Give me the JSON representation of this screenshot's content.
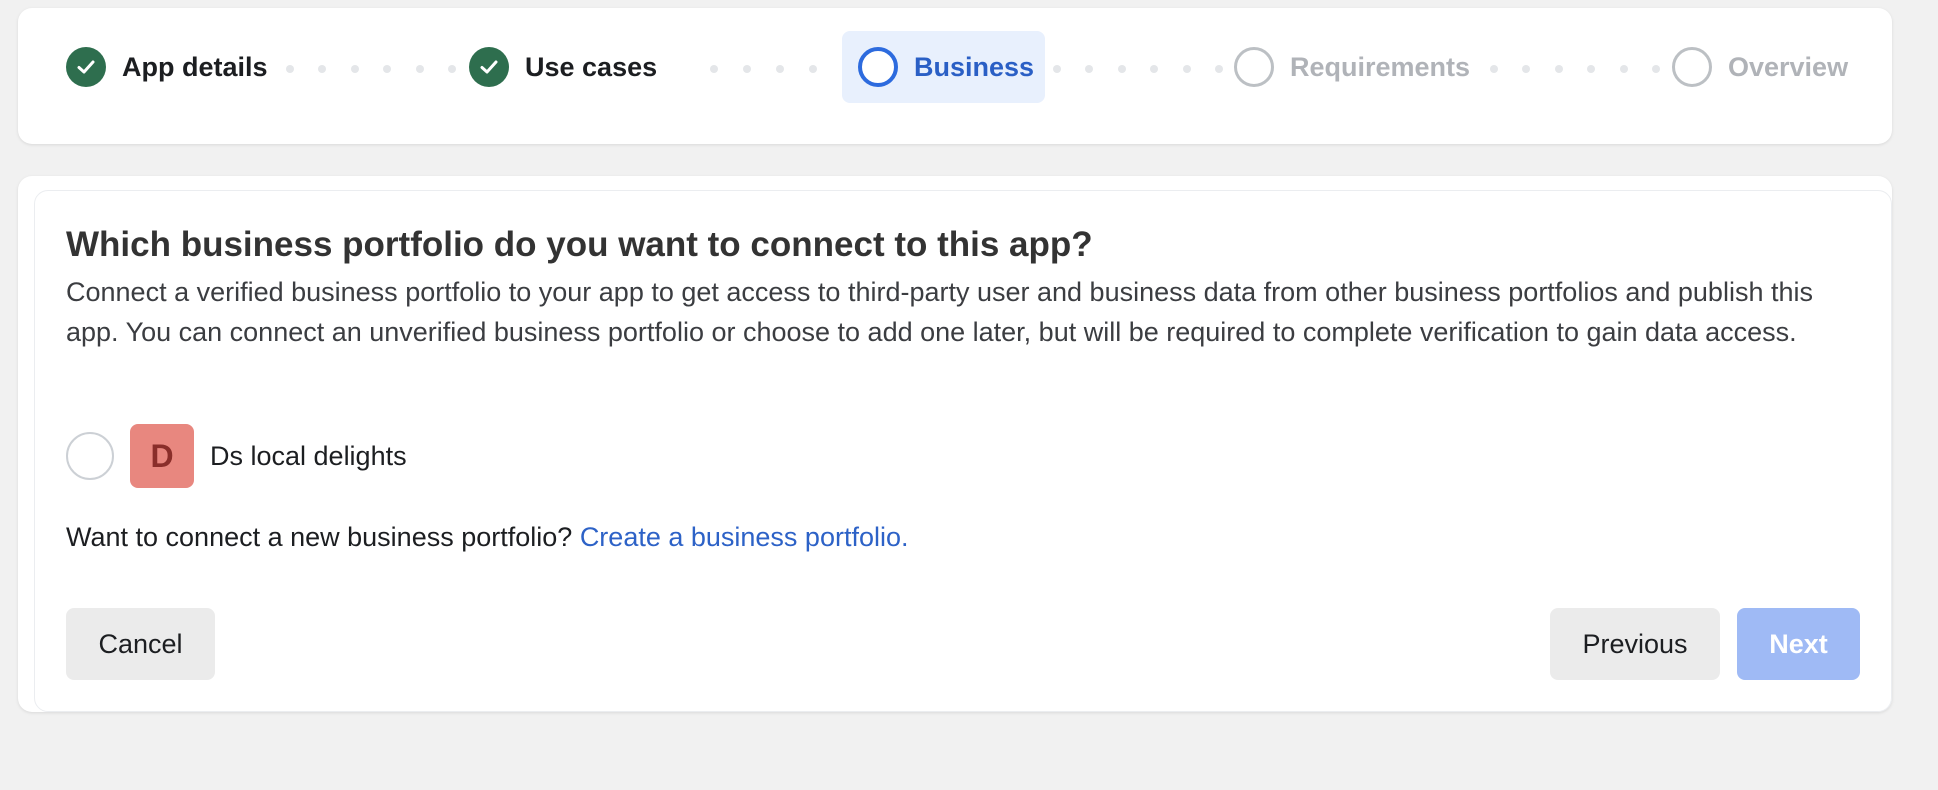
{
  "stepper": {
    "steps": [
      {
        "label": "App details",
        "state": "done"
      },
      {
        "label": "Use cases",
        "state": "done"
      },
      {
        "label": "Business",
        "state": "current"
      },
      {
        "label": "Requirements",
        "state": "upcoming"
      },
      {
        "label": "Overview",
        "state": "upcoming"
      }
    ]
  },
  "content": {
    "title": "Which business portfolio do you want to connect to this app?",
    "description": "Connect a verified business portfolio to your app to get access to third-party user and business data from other business portfolios and publish this app. You can connect an unverified business portfolio or choose to add one later, but will be required to complete verification to gain data access.",
    "portfolio": {
      "avatar_letter": "D",
      "name": "Ds local delights",
      "selected": false
    },
    "create_prompt": "Want to connect a new business portfolio?",
    "create_link": "Create a business portfolio."
  },
  "buttons": {
    "cancel": "Cancel",
    "previous": "Previous",
    "next": "Next"
  },
  "colors": {
    "done": "#2e6e4e",
    "current": "#2d6bde",
    "upcoming": "#bcc0c4",
    "link": "#2d62c7",
    "next_disabled": "#9fbaf5",
    "avatar_bg": "#e8877f"
  }
}
